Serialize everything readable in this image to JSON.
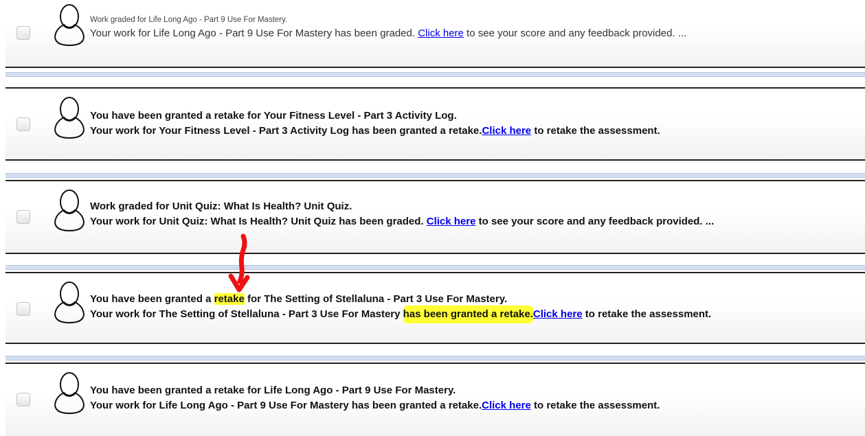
{
  "notifications": [
    {
      "title": "Work graded for Life Long Ago - Part 9 Use For Mastery.",
      "body_before": "Your work for Life Long Ago - Part 9 Use For Mastery has been graded. ",
      "link": "Click here",
      "body_after": " to see your score and any feedback provided. ..."
    },
    {
      "title": "You have been granted a retake for Your Fitness Level - Part 3 Activity Log.",
      "body_before": "Your work for Your Fitness Level - Part 3 Activity Log has been granted a retake.",
      "link": "Click here",
      "body_after": " to retake the assessment."
    },
    {
      "title": "Work graded for Unit Quiz: What Is Health? Unit Quiz.",
      "body_before": "Your work for Unit Quiz: What Is Health? Unit Quiz has been graded. ",
      "link": "Click here",
      "body_after": " to see your score and any feedback provided. ..."
    },
    {
      "title_before": "You have been granted a ",
      "title_highlight": "retake",
      "title_after": " for The Setting of Stellaluna - Part 3 Use For Mastery.",
      "body_before": "Your work for The Setting of Stellaluna - Part 3 Use For Mastery ",
      "body_highlight": "has been granted a retake.",
      "link": "Click here",
      "body_after": " to retake the assessment."
    },
    {
      "title": "You have been granted a retake for Life Long Ago - Part 9 Use For Mastery.",
      "body_before": "Your work for Life Long Ago - Part 9 Use For Mastery has been granted a retake.",
      "link": "Click here",
      "body_after": " to retake the assessment."
    }
  ],
  "colors": {
    "link": "#0000ee",
    "highlight": "#ffff33",
    "annotation_arrow": "#ee1111"
  },
  "icons": {
    "avatar": "user-outline-icon",
    "annotation": "red-arrow-annotation-icon"
  }
}
